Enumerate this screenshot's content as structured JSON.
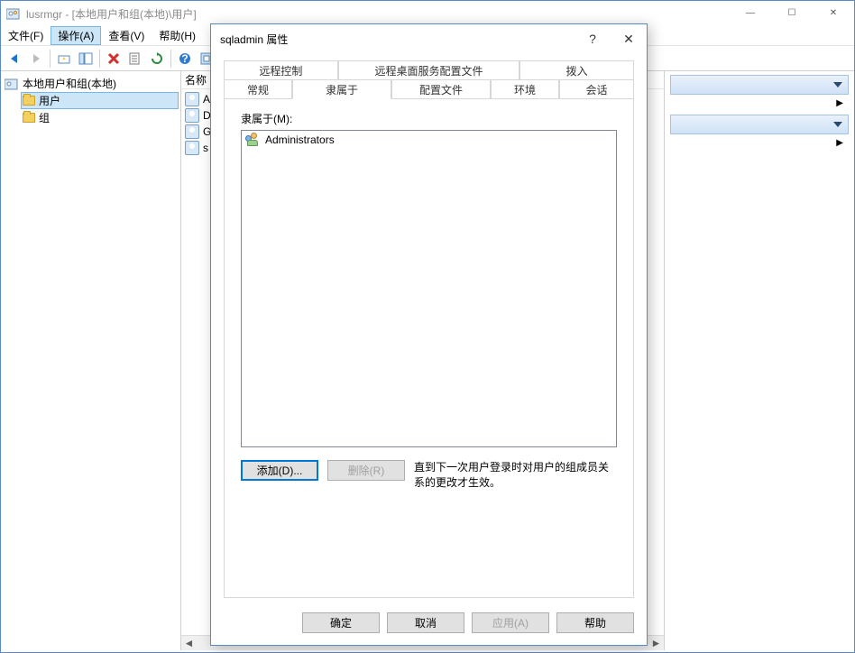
{
  "window": {
    "title": "lusrmgr - [本地用户和组(本地)\\用户]"
  },
  "menu": {
    "file": "文件(F)",
    "action": "操作(A)",
    "view": "查看(V)",
    "help": "帮助(H)"
  },
  "tree": {
    "root": "本地用户和组(本地)",
    "users": "用户",
    "groups": "组"
  },
  "mid": {
    "col_name": "名称",
    "items": [
      "A",
      "D",
      "G",
      "s"
    ]
  },
  "actions": {},
  "dialog": {
    "title": "sqladmin 属性",
    "tabs_row1": {
      "remotectrl": "远程控制",
      "rds": "远程桌面服务配置文件",
      "dialin": "拨入"
    },
    "tabs_row2": {
      "general": "常规",
      "memberof": "隶属于",
      "profile": "配置文件",
      "env": "环境",
      "session": "会话"
    },
    "memberof_label": "隶属于(M):",
    "groups": [
      {
        "name": "Administrators"
      }
    ],
    "add_btn": "添加(D)...",
    "remove_btn": "删除(R)",
    "note": "直到下一次用户登录时对用户的组成员关系的更改才生效。",
    "ok": "确定",
    "cancel": "取消",
    "apply": "应用(A)",
    "help": "帮助"
  }
}
